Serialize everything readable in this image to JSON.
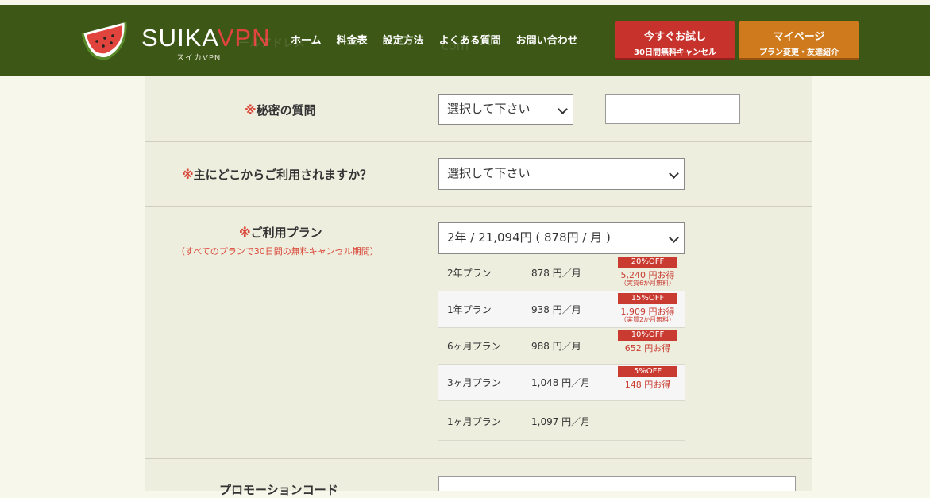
{
  "brand": {
    "name": "SUIKA",
    "name_accent": "VPN",
    "sub": "スイカVPN"
  },
  "ghost": {
    "a": "ールアドレス",
    "b": "com"
  },
  "nav": [
    "ホーム",
    "料金表",
    "設定方法",
    "よくある質問",
    "お問い合わせ"
  ],
  "cta": {
    "trial_main": "今すぐお試し",
    "trial_sub": "30日間無料キャンセル",
    "mypage_main": "マイページ",
    "mypage_sub": "プラン変更・友達紹介"
  },
  "form": {
    "required_mark": "※",
    "secret_question": {
      "label": "秘密の質問",
      "select": "選択して下さい",
      "answer": ""
    },
    "where_use": {
      "label": "主にどこからご利用されますか？",
      "select": "選択して下さい"
    },
    "plan": {
      "label": "ご利用プラン",
      "note": "（すべてのプランで30日間の無料キャンセル期間）",
      "select": "2年 / 21,094円 ( 878円 / 月 )",
      "rows": [
        {
          "name": "2年プラン",
          "price": "878 円／月",
          "badge": "20%OFF",
          "saving": "5,240 円お得",
          "saving_note": "（実質6か月無料）"
        },
        {
          "name": "1年プラン",
          "price": "938 円／月",
          "badge": "15%OFF",
          "saving": "1,909 円お得",
          "saving_note": "（実質2か月無料）"
        },
        {
          "name": "6ヶ月プラン",
          "price": "988 円／月",
          "badge": "10%OFF",
          "saving": "652 円お得",
          "saving_note": ""
        },
        {
          "name": "3ヶ月プラン",
          "price": "1,048 円／月",
          "badge": "5%OFF",
          "saving": "148 円お得",
          "saving_note": ""
        },
        {
          "name": "1ヶ月プラン",
          "price": "1,097 円／月",
          "badge": "",
          "saving": "",
          "saving_note": ""
        }
      ]
    },
    "promo": {
      "label": "プロモーションコード"
    }
  },
  "colors": {
    "header": "#3c5716",
    "trial": "#c8322c",
    "mypage": "#cf7a1c",
    "accent": "#d94536"
  }
}
